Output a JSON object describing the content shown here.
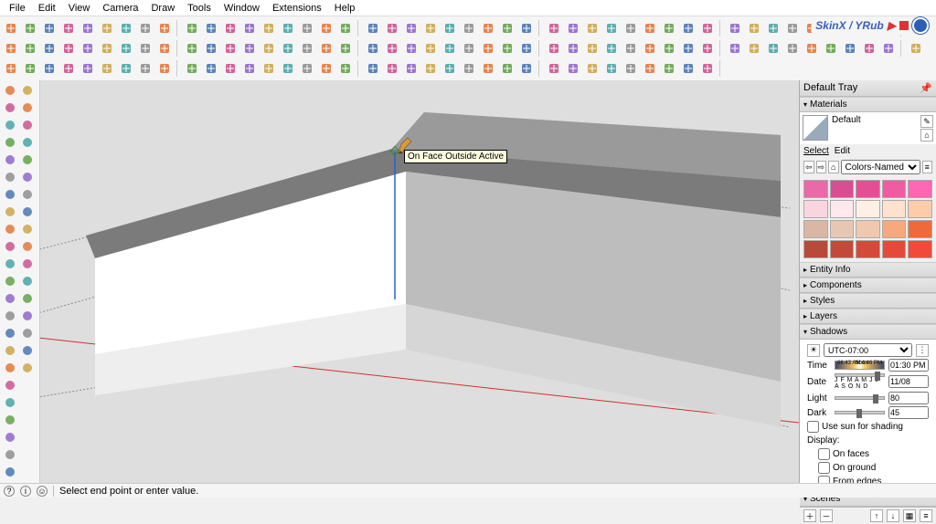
{
  "menu": [
    "File",
    "Edit",
    "View",
    "Camera",
    "Draw",
    "Tools",
    "Window",
    "Extensions",
    "Help"
  ],
  "skinx": {
    "text": "SkinX / YRub"
  },
  "tray": {
    "title": "Default Tray",
    "materials": {
      "head": "Materials",
      "name": "Default",
      "tabs": [
        "Select",
        "Edit"
      ],
      "dropdown": "Colors-Named"
    },
    "swatches": [
      "#e86aa8",
      "#d94e92",
      "#e54e92",
      "#f05ca2",
      "#ff66b3",
      "#f9d5df",
      "#ffe8ee",
      "#fff0e6",
      "#ffe1cf",
      "#ffccaa",
      "#d9b7a2",
      "#e8c7b2",
      "#f0c8b0",
      "#f7a97d",
      "#ef6a3b",
      "#b84a3a",
      "#c24a3a",
      "#d24a3a",
      "#e34a3a",
      "#f04a3a"
    ],
    "panels": [
      "Entity Info",
      "Components",
      "Styles",
      "Layers"
    ],
    "shadows": {
      "head": "Shadows",
      "tz": "UTC-07:00",
      "timeLabel": "Time",
      "timeStart": "06:43 AM",
      "timeNoon": "Noon",
      "timeEnd": "4:46 PM",
      "timeVal": "01:30 PM",
      "dateLabel": "Date",
      "months": "J F M A M J J A S O N D",
      "dateVal": "11/08",
      "lightLabel": "Light",
      "lightVal": "80",
      "darkLabel": "Dark",
      "darkVal": "45",
      "useSun": "Use sun for shading",
      "display": "Display:",
      "onFaces": "On faces",
      "onGround": "On ground",
      "fromEdges": "From edges"
    },
    "scenes": {
      "head": "Scenes"
    }
  },
  "tooltip": "On Face Outside Active",
  "status": {
    "text": "Select end point or enter value."
  }
}
